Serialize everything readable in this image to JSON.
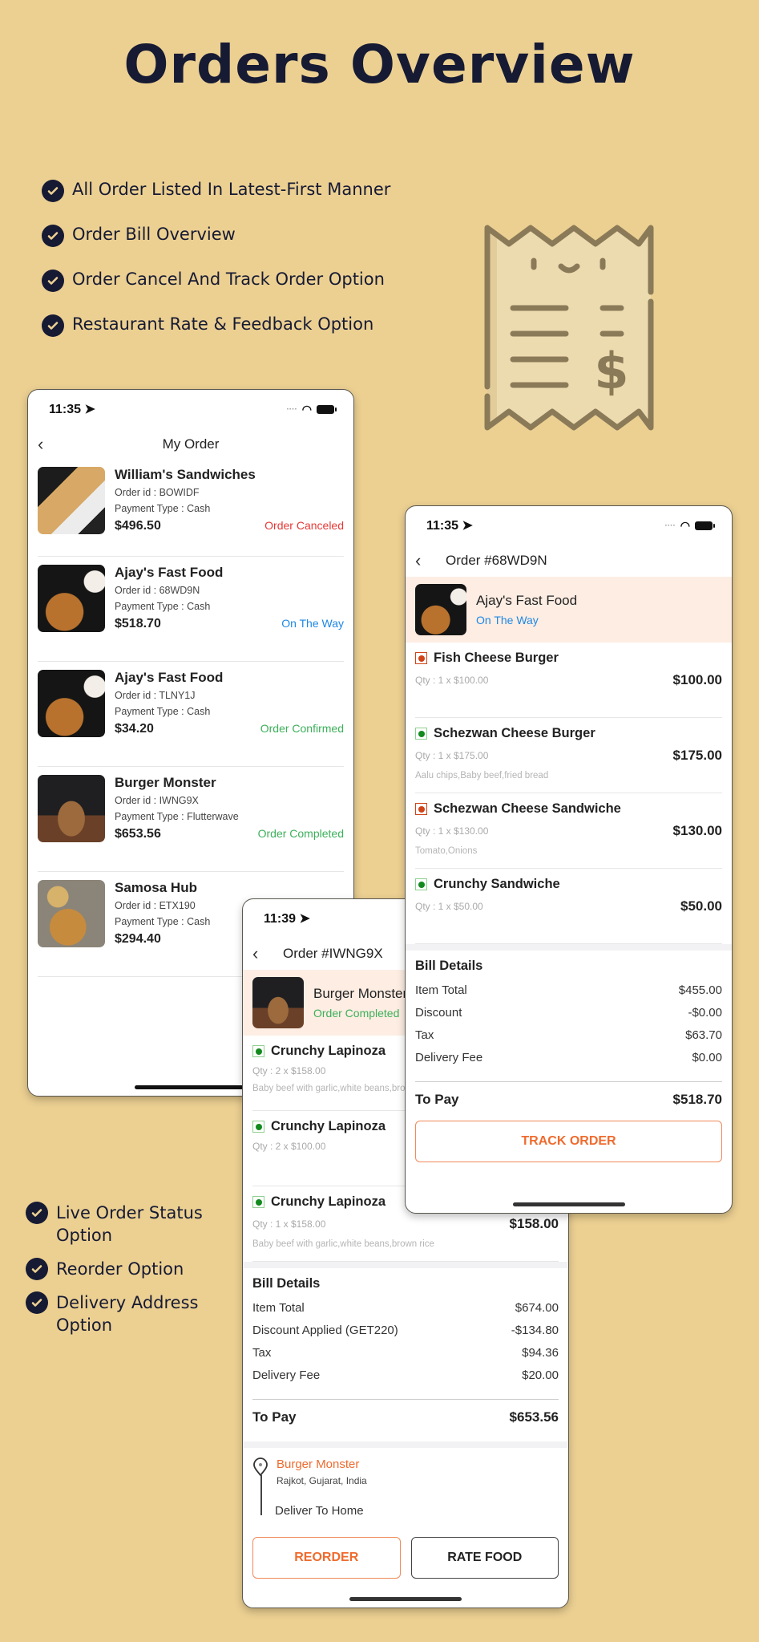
{
  "hero": {
    "title": "Orders Overview"
  },
  "features_top": [
    "All Order Listed In Latest-First Manner",
    "Order Bill Overview",
    "Order Cancel And Track Order Option",
    "Restaurant Rate & Feedback Option"
  ],
  "features_bottom": [
    "Live Order Status Option",
    "Reorder Option",
    "Delivery Address Option"
  ],
  "colors": {
    "background": "#ecd092",
    "canceled": "#e53935",
    "on_the_way": "#1e88e5",
    "confirmed": "#3cb05a",
    "completed": "#3cb05a",
    "accent": "#ef6b2e",
    "nonveg": "#d04418",
    "veg": "#138a1e"
  },
  "my_orders": {
    "status_time": "11:35",
    "title": "My Order",
    "orders": [
      {
        "restaurant": "William's Sandwiches",
        "order_id": "Order id : BOWIDF",
        "payment": "Payment Type : Cash",
        "total": "$496.50",
        "status": "Order Canceled",
        "status_key": "canceled"
      },
      {
        "restaurant": "Ajay's Fast Food",
        "order_id": "Order id : 68WD9N",
        "payment": "Payment Type : Cash",
        "total": "$518.70",
        "status": "On The Way",
        "status_key": "on_the_way"
      },
      {
        "restaurant": "Ajay's Fast Food",
        "order_id": "Order id : TLNY1J",
        "payment": "Payment Type : Cash",
        "total": "$34.20",
        "status": "Order Confirmed",
        "status_key": "confirmed"
      },
      {
        "restaurant": "Burger Monster",
        "order_id": "Order id : IWNG9X",
        "payment": "Payment Type : Flutterwave",
        "total": "$653.56",
        "status": "Order Completed",
        "status_key": "completed"
      },
      {
        "restaurant": "Samosa Hub",
        "order_id": "Order id : ETX190",
        "payment": "Payment Type : Cash",
        "total": "$294.40",
        "status": "",
        "status_key": ""
      }
    ]
  },
  "order_68wd9n": {
    "status_time": "11:35",
    "title": "Order #68WD9N",
    "restaurant": "Ajay's Fast Food",
    "status": "On The Way",
    "items": [
      {
        "name": "Fish Cheese Burger",
        "type": "nonveg",
        "qty": "Qty : 1 x $100.00",
        "total": "$100.00",
        "addons": ""
      },
      {
        "name": "Schezwan Cheese Burger",
        "type": "veg",
        "qty": "Qty : 1 x $175.00",
        "total": "$175.00",
        "addons": "Aalu chips,Baby beef,fried bread"
      },
      {
        "name": "Schezwan Cheese Sandwiche",
        "type": "nonveg",
        "qty": "Qty : 1 x $130.00",
        "total": "$130.00",
        "addons": "Tomato,Onions"
      },
      {
        "name": "Crunchy Sandwiche",
        "type": "veg",
        "qty": "Qty : 1 x $50.00",
        "total": "$50.00",
        "addons": ""
      }
    ],
    "bill": {
      "title": "Bill Details",
      "rows": [
        {
          "label": "Item Total",
          "value": "$455.00"
        },
        {
          "label": "Discount",
          "value": "-$0.00"
        },
        {
          "label": "Tax",
          "value": "$63.70"
        },
        {
          "label": "Delivery Fee",
          "value": "$0.00"
        }
      ],
      "to_pay_label": "To Pay",
      "to_pay_value": "$518.70"
    },
    "track_button": "TRACK ORDER"
  },
  "order_iwng9x": {
    "status_time": "11:39",
    "title": "Order #IWNG9X",
    "restaurant": "Burger Monster",
    "status": "Order Completed",
    "items": [
      {
        "name": "Crunchy Lapinoza",
        "type": "veg",
        "qty": "Qty : 2 x $158.00",
        "total": "",
        "addons": "Baby beef with garlic,white beans,brown rice"
      },
      {
        "name": "Crunchy Lapinoza",
        "type": "veg",
        "qty": "Qty : 2 x $100.00",
        "total": "",
        "addons": ""
      },
      {
        "name": "Crunchy Lapinoza",
        "type": "veg",
        "qty": "Qty : 1 x $158.00",
        "total": "$158.00",
        "addons": "Baby beef with garlic,white beans,brown rice"
      }
    ],
    "bill": {
      "title": "Bill Details",
      "rows": [
        {
          "label": "Item Total",
          "value": "$674.00"
        },
        {
          "label": "Discount Applied (GET220)",
          "value": "-$134.80"
        },
        {
          "label": "Tax",
          "value": "$94.36"
        },
        {
          "label": "Delivery Fee",
          "value": "$20.00"
        }
      ],
      "to_pay_label": "To Pay",
      "to_pay_value": "$653.56"
    },
    "pickup_name": "Burger Monster",
    "pickup_address": "Rajkot, Gujarat, India",
    "deliver_label": "Deliver To Home",
    "reorder_button": "REORDER",
    "rate_button": "RATE FOOD"
  }
}
